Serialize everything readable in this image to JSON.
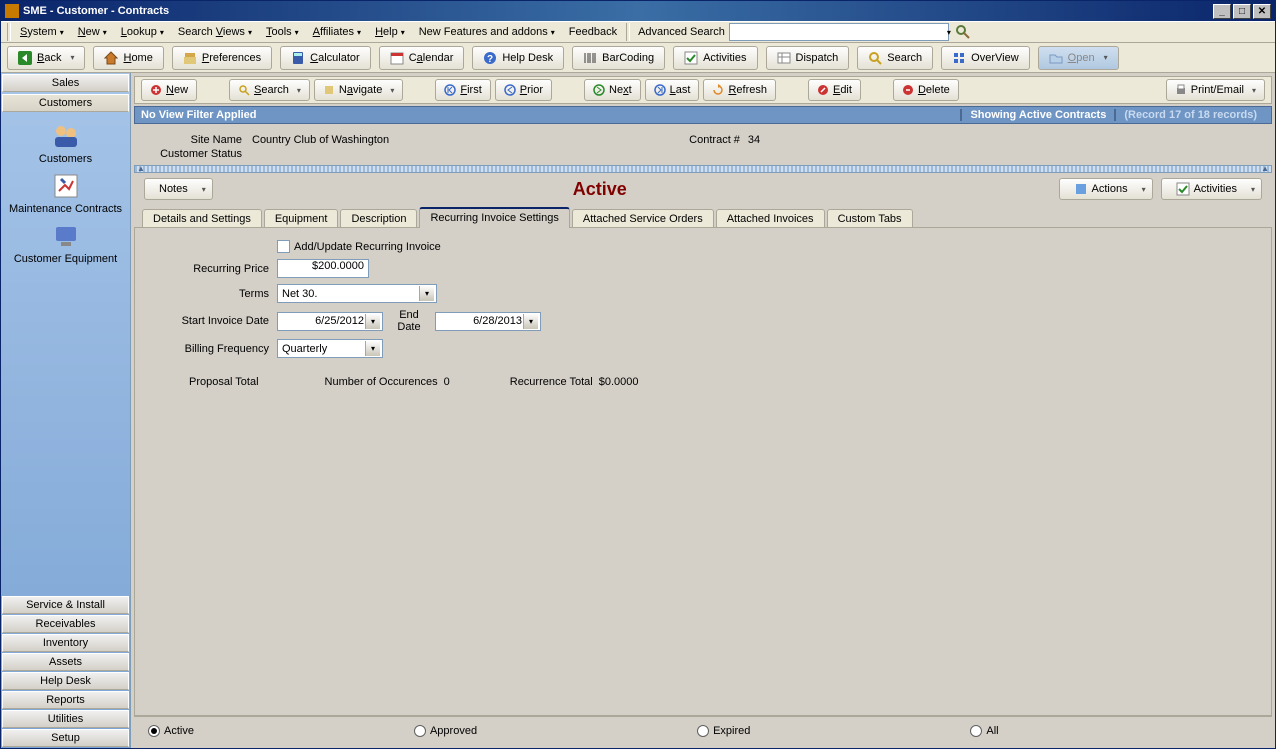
{
  "title": "SME - Customer - Contracts",
  "menu": [
    "System",
    "New",
    "Lookup",
    "Search Views",
    "Tools",
    "Affiliates",
    "Help",
    "New Features and addons",
    "Feedback"
  ],
  "advsearch_label": "Advanced Search",
  "toolbar": {
    "back": "Back",
    "home": "Home",
    "preferences": "Preferences",
    "calculator": "Calculator",
    "calendar": "Calendar",
    "helpdesk": "Help Desk",
    "barcoding": "BarCoding",
    "activities": "Activities",
    "dispatch": "Dispatch",
    "search": "Search",
    "overview": "OverView",
    "open": "Open"
  },
  "sidebar": {
    "top": [
      "Sales",
      "Customers"
    ],
    "icons": [
      {
        "label": "Customers"
      },
      {
        "label": "Maintenance Contracts"
      },
      {
        "label": "Customer Equipment"
      }
    ],
    "bottom": [
      "Service & Install",
      "Receivables",
      "Inventory",
      "Assets",
      "Help Desk",
      "Reports",
      "Utilities",
      "Setup"
    ]
  },
  "nav": {
    "new": "New",
    "search": "Search",
    "navigate": "Navigate",
    "first": "First",
    "prior": "Prior",
    "next": "Next",
    "last": "Last",
    "refresh": "Refresh",
    "edit": "Edit",
    "delete": "Delete",
    "print": "Print/Email"
  },
  "filterbar": {
    "left": "No View Filter Applied",
    "center": "Showing Active Contracts",
    "right": "(Record 17 of 18 records)"
  },
  "info": {
    "site_label": "Site Name",
    "site_value": "Country Club of Washington",
    "status_label": "Customer Status",
    "contract_label": "Contract #",
    "contract_value": "34"
  },
  "notes_label": "Notes",
  "status_text": "Active",
  "actions_label": "Actions",
  "activities_label": "Activities",
  "tabs": [
    "Details and Settings",
    "Equipment",
    "Description",
    "Recurring Invoice Settings",
    "Attached Service Orders",
    "Attached Invoices",
    "Custom Tabs"
  ],
  "active_tab_index": 3,
  "form": {
    "add_update_label": "Add/Update Recurring Invoice",
    "price_label": "Recurring Price",
    "price_value": "$200.0000",
    "terms_label": "Terms",
    "terms_value": "Net 30.",
    "start_label": "Start Invoice Date",
    "start_value": "6/25/2012",
    "end_label": "End Date",
    "end_value": "6/28/2013",
    "freq_label": "Billing Frequency",
    "freq_value": "Quarterly",
    "proposal_label": "Proposal Total",
    "occurrence_label": "Number of Occurences",
    "occurrence_value": "0",
    "recurrence_label": "Recurrence Total",
    "recurrence_value": "$0.0000"
  },
  "radios": [
    "Active",
    "Approved",
    "Expired",
    "All"
  ],
  "radio_checked": 0
}
